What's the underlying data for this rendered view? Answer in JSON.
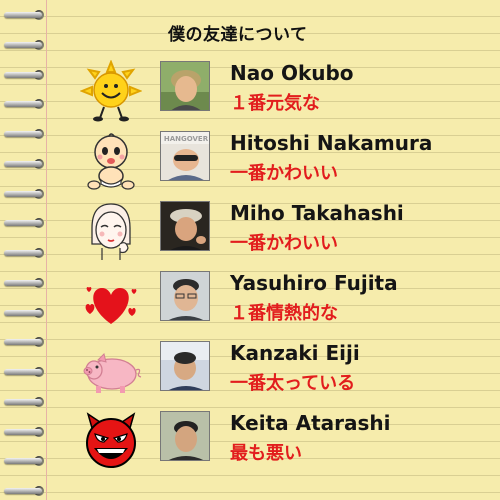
{
  "heading": "僕の友達について",
  "friends": [
    {
      "name": "Nao Okubo",
      "description": "１番元気な",
      "character_icon": "smiling-sun-character-icon",
      "photo_icon": "person-photo-icon"
    },
    {
      "name": "Hitoshi Nakamura",
      "description": "一番かわいい",
      "character_icon": "baby-character-icon",
      "photo_icon": "person-photo-icon",
      "photo_banner": "HANGOVER"
    },
    {
      "name": "Miho Takahashi",
      "description": "一番かわいい",
      "character_icon": "girl-face-character-icon",
      "photo_icon": "person-photo-icon"
    },
    {
      "name": "Yasuhiro Fujita",
      "description": "１番情熱的な",
      "character_icon": "hearts-icon",
      "photo_icon": "person-photo-icon"
    },
    {
      "name": "Kanzaki Eiji",
      "description": "一番太っている",
      "character_icon": "pig-icon",
      "photo_icon": "person-photo-icon"
    },
    {
      "name": "Keita Atarashi",
      "description": "最も悪い",
      "character_icon": "devil-face-icon",
      "photo_icon": "person-photo-icon"
    }
  ],
  "colors": {
    "paper": "#f6ecac",
    "name_text": "#151515",
    "description_text": "#e21d1d"
  }
}
